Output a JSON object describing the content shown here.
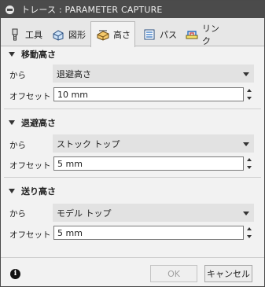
{
  "window": {
    "title": "トレース : PARAMETER CAPTURE"
  },
  "tabs": [
    {
      "label": "工具",
      "icon": "tool-icon",
      "active": false
    },
    {
      "label": "図形",
      "icon": "geometry-icon",
      "active": false
    },
    {
      "label": "高さ",
      "icon": "heights-icon",
      "active": true
    },
    {
      "label": "パス",
      "icon": "passes-icon",
      "active": false
    },
    {
      "label": "リンク",
      "icon": "linking-icon",
      "active": false
    }
  ],
  "sections": [
    {
      "title": "移動高さ",
      "from_label": "から",
      "from_value": "退避高さ",
      "offset_label": "オフセット",
      "offset_value": "10 mm"
    },
    {
      "title": "退避高さ",
      "from_label": "から",
      "from_value": "ストック トップ",
      "offset_label": "オフセット",
      "offset_value": "5 mm"
    },
    {
      "title": "送り高さ",
      "from_label": "から",
      "from_value": "モデル トップ",
      "offset_label": "オフセット",
      "offset_value": "5 mm"
    }
  ],
  "footer": {
    "info_icon": "i",
    "ok_label": "OK",
    "cancel_label": "キャンセル"
  },
  "colors": {
    "titlebar": "#4b4b4b",
    "dialog_bg": "#f2f2f2",
    "tab_active_bg": "#f2f2f2"
  }
}
